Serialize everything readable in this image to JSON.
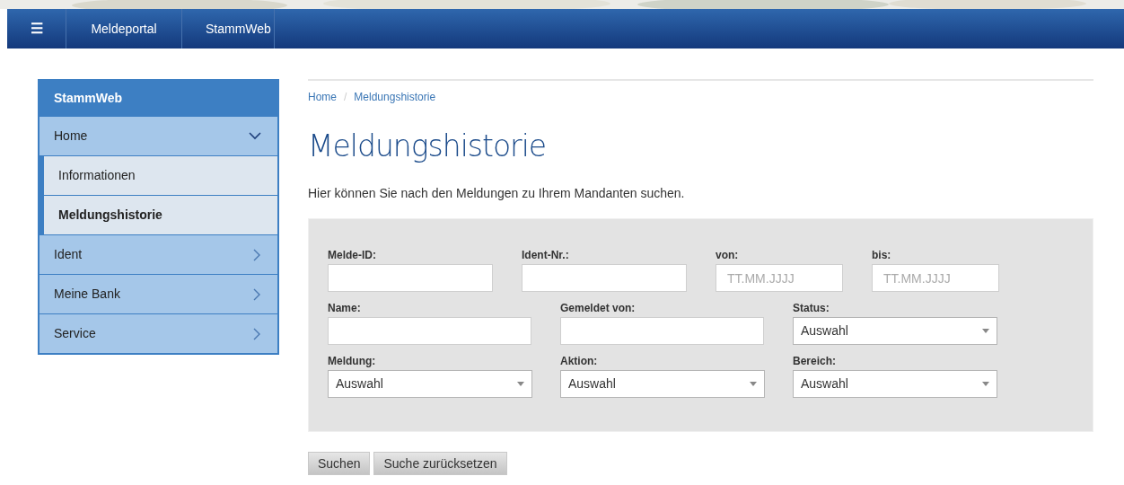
{
  "navbar": {
    "menu_icon": "☰",
    "items": [
      {
        "label": "Meldeportal",
        "selected": false
      },
      {
        "label": "StammWeb",
        "selected": false
      }
    ]
  },
  "sidebar": {
    "title": "StammWeb",
    "items": [
      {
        "label": "Home",
        "expanded": true,
        "children": [
          {
            "label": "Informationen",
            "selected": false
          },
          {
            "label": "Meldungshistorie",
            "selected": true
          }
        ]
      },
      {
        "label": "Ident",
        "expanded": false
      },
      {
        "label": "Meine Bank",
        "expanded": false
      },
      {
        "label": "Service",
        "expanded": false
      }
    ]
  },
  "breadcrumb": {
    "separator": "/",
    "items": [
      "Home",
      "Meldungshistorie"
    ]
  },
  "title": "Meldungshistorie",
  "description": "Hier können Sie nach den Meldungen zu Ihrem Mandanten suchen.",
  "form_rows": [
    [
      {
        "label": "Melde-ID:",
        "kind": "text"
      },
      {
        "label": "Ident-Nr.:",
        "kind": "text"
      },
      {
        "label": "von:",
        "kind": "date",
        "placeholder": "TT.MM.JJJJ"
      },
      {
        "label": "bis:",
        "kind": "date",
        "placeholder": "TT.MM.JJJJ"
      }
    ],
    [
      {
        "label": "Name:",
        "kind": "text"
      },
      {
        "label": "Gemeldet von:",
        "kind": "text"
      },
      {
        "label": "Status:",
        "kind": "select",
        "value": "Auswahl"
      }
    ],
    [
      {
        "label": "Meldung:",
        "kind": "select",
        "value": "Auswahl"
      },
      {
        "label": "Aktion:",
        "kind": "select",
        "value": "Auswahl"
      },
      {
        "label": "Bereich:",
        "kind": "select",
        "value": "Auswahl"
      }
    ]
  ],
  "buttons": [
    "Suchen",
    "Suche zurücksetzen"
  ]
}
